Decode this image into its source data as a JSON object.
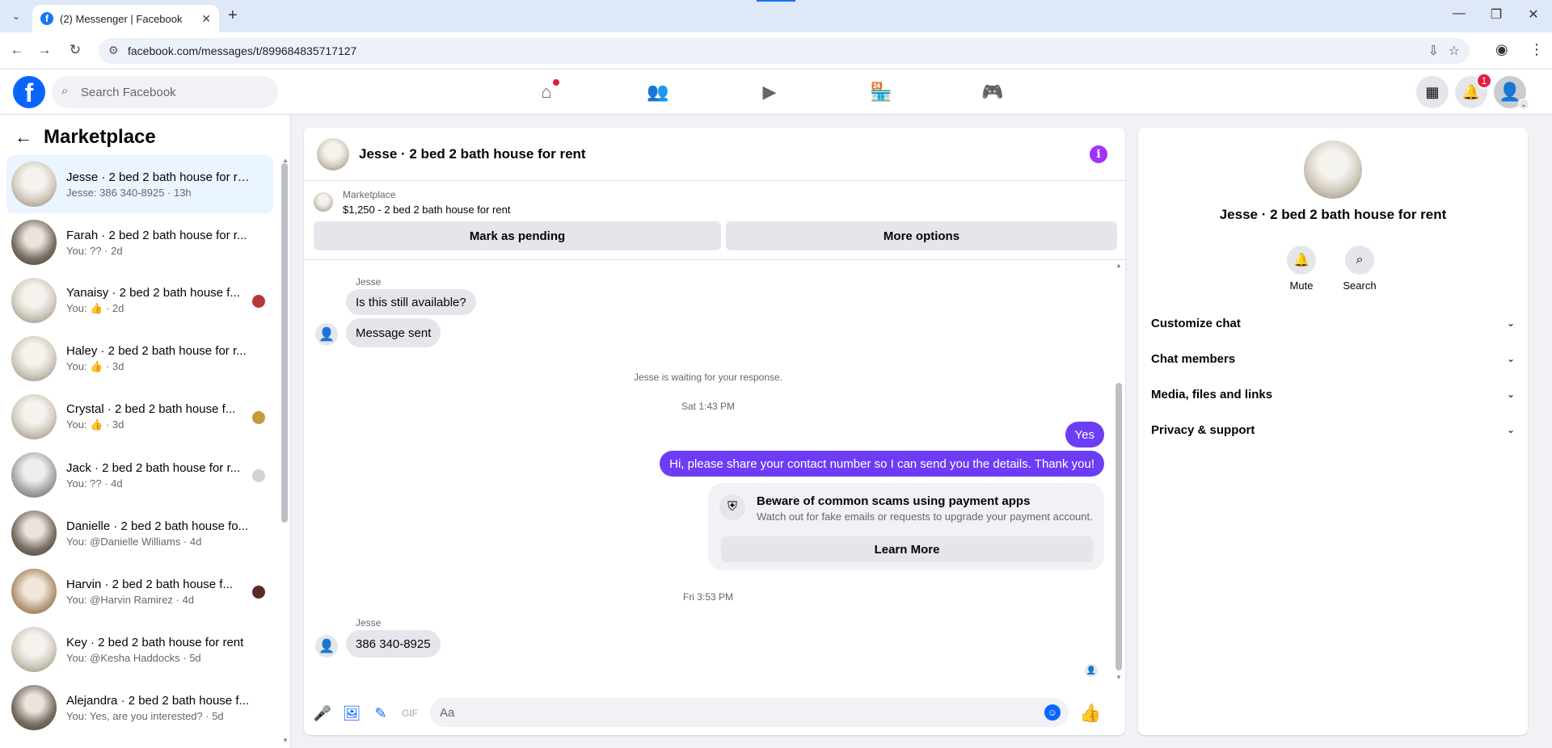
{
  "browser": {
    "tab_title": "(2) Messenger | Facebook",
    "url": "facebook.com/messages/t/899684835717127"
  },
  "fb": {
    "search_placeholder": "Search Facebook",
    "notif_count": "1"
  },
  "left": {
    "title": "Marketplace",
    "conversations": [
      {
        "name": "Jesse · 2 bed 2 bath house for re...",
        "sub": "Jesse: 386 340-8925 · 13h"
      },
      {
        "name": "Farah · 2 bed 2 bath house for r...",
        "sub": "You: ?? · 2d"
      },
      {
        "name": "Yanaisy · 2 bed 2 bath house f...",
        "sub": "You: 👍 · 2d"
      },
      {
        "name": "Haley · 2 bed 2 bath house for r...",
        "sub": "You: 👍 · 3d"
      },
      {
        "name": "Crystal · 2 bed 2 bath house f...",
        "sub": "You: 👍 · 3d"
      },
      {
        "name": "Jack · 2 bed 2 bath house for r...",
        "sub": "You: ?? · 4d"
      },
      {
        "name": "Danielle · 2 bed 2 bath house fo...",
        "sub": "You: @Danielle Williams · 4d"
      },
      {
        "name": "Harvin · 2 bed 2 bath house f...",
        "sub": "You: @Harvin Ramirez · 4d"
      },
      {
        "name": "Key · 2 bed 2 bath house for rent",
        "sub": "You: @Kesha Haddocks · 5d"
      },
      {
        "name": "Alejandra · 2 bed 2 bath house f...",
        "sub": "You: Yes, are you interested? · 5d"
      }
    ]
  },
  "chat": {
    "title": "Jesse · 2 bed 2 bath house for rent",
    "listing_label": "Marketplace",
    "listing_price": "$1,250 - 2 bed 2 bath house for rent",
    "btn_pending": "Mark as pending",
    "btn_more": "More options",
    "sender1": "Jesse",
    "msg1": "Is this still available?",
    "msg2": "Message sent",
    "waiting": "Jesse is waiting for your response.",
    "time1": "Sat 1:43 PM",
    "msg3": "Yes",
    "msg4": "Hi, please share your contact number so I can send you the details. Thank you!",
    "scam_title": "Beware of common scams using payment apps",
    "scam_desc": "Watch out for fake emails or requests to upgrade your payment account.",
    "scam_btn": "Learn More",
    "time2": "Fri 3:53 PM",
    "sender2": "Jesse",
    "msg5": "386 340-8925",
    "composer_placeholder": "Aa"
  },
  "right": {
    "name": "Jesse · 2 bed 2 bath house for rent",
    "mute": "Mute",
    "search": "Search",
    "sections": [
      "Customize chat",
      "Chat members",
      "Media, files and links",
      "Privacy & support"
    ]
  }
}
